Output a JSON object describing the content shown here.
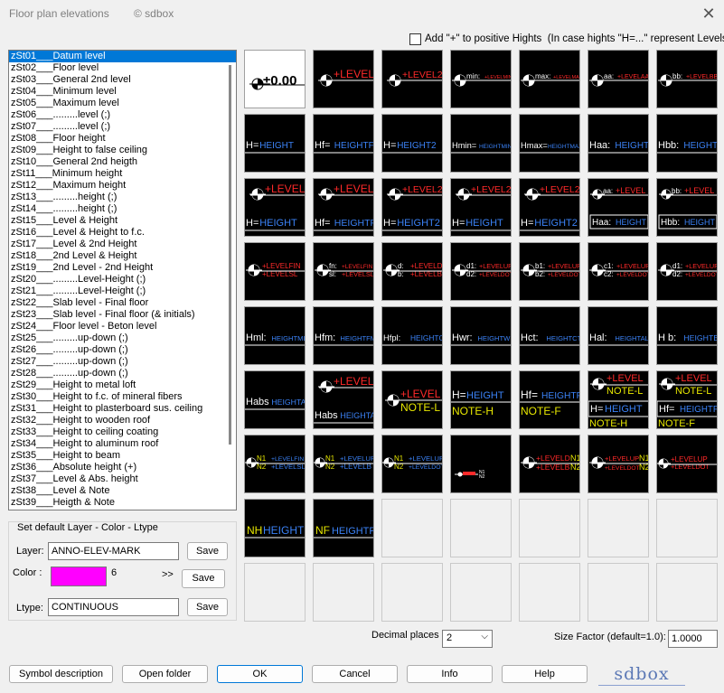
{
  "window": {
    "title": "Floor plan elevations",
    "copyright": "© sdbox",
    "close_icon": "close-icon"
  },
  "options": {
    "plus_label": "Add \"+\" to positive Hights  (In case hights \"H=...\" represent Levels).",
    "plus_checked": false
  },
  "symbols": [
    "zSt01___Datum level",
    "zSt02___Floor level",
    "zSt03___General 2nd level",
    "zSt04___Minimum level",
    "zSt05___Maximum level",
    "zSt06___.........level (;)",
    "zSt07___.........level (;)",
    "zSt08___Floor height",
    "zSt09___Height to false ceiling",
    "zSt10___General 2nd heigth",
    "zSt11___Minimum height",
    "zSt12___Maximum height",
    "zSt13___.........height (;)",
    "zSt14___.........height (;)",
    "zSt15___Level & Height",
    "zSt16___Level & Height to f.c.",
    "zSt17___Level & 2nd Height",
    "zSt18___2nd Level & Height",
    "zSt19___2nd Level - 2nd Height",
    "zSt20___.........Level-Height (;)",
    "zSt21___.........Level-Height (;)",
    "zSt22___Slab level - Final floor",
    "zSt23___Slab level - Final floor (& initials)",
    "zSt24___Floor level - Beton level",
    "zSt25___.........up-down (;)",
    "zSt26___.........up-down (;)",
    "zSt27___.........up-down (;)",
    "zSt28___.........up-down (;)",
    "zSt29___Height to metal loft",
    "zSt30___Height to f.c. of mineral fibers",
    "zSt31___Height to plasterboard sus. ceiling",
    "zSt32___Height to wooden roof",
    "zSt33___Height to ceiling coating",
    "zSt34___Height to aluminum roof",
    "zSt35___Height to beam",
    "zSt36___Absolute height (+)",
    "zSt37___Level & Abs. height",
    "zSt38___Level & Note",
    "zSt39___Heigth & Note"
  ],
  "selected_index": 0,
  "defaults": {
    "group_label": "Set default Layer - Color - Ltype",
    "layer_label": "Layer:",
    "layer_value": "ANNO-ELEV-MARK",
    "color_label": "Color :",
    "color_value": "6",
    "color_hex": "#ff00ff",
    "more_label": ">>",
    "ltype_label": "Ltype:",
    "ltype_value": "CONTINUOUS",
    "save_label": "Save"
  },
  "cells": [
    {
      "t": "datum",
      "a": "±0.00"
    },
    {
      "t": "lv",
      "a": "+LEVEL"
    },
    {
      "t": "lv",
      "a": "+LEVEL2"
    },
    {
      "t": "lvs",
      "p": "min:",
      "a": "+LEVELMIN"
    },
    {
      "t": "lvs",
      "p": "max:",
      "a": "+LEVELMAX"
    },
    {
      "t": "lvs",
      "p": "aa:",
      "a": "+LEVELAA"
    },
    {
      "t": "lvs",
      "p": "bb:",
      "a": "+LEVELBB"
    },
    {
      "t": "h",
      "p": "H=",
      "b": "HEIGHT"
    },
    {
      "t": "h",
      "p": "Hf=",
      "b": "HEIGHTF"
    },
    {
      "t": "h",
      "p": "H=",
      "b": "HEIGHT2"
    },
    {
      "t": "h",
      "p": "Hmin=",
      "b": "HEIGHTMIN"
    },
    {
      "t": "h",
      "p": "Hmax=",
      "b": "HEIGHTMAX"
    },
    {
      "t": "h",
      "p": "Haa:",
      "b": "HEIGHT"
    },
    {
      "t": "h",
      "p": "Hbb:",
      "b": "HEIGHT"
    },
    {
      "t": "lh",
      "a": "+LEVEL",
      "p": "H=",
      "b": "HEIGHT"
    },
    {
      "t": "lh",
      "a": "+LEVEL",
      "p": "Hf=",
      "b": "HEIGHTF"
    },
    {
      "t": "lh",
      "a": "+LEVEL2",
      "p": "H=",
      "b": "HEIGHT2"
    },
    {
      "t": "lh",
      "a": "+LEVEL2",
      "p": "H=",
      "b": "HEIGHT"
    },
    {
      "t": "lh",
      "a": "+LEVEL2",
      "p": "H=",
      "b": "HEIGHT2"
    },
    {
      "t": "lhs",
      "p0": "aa:",
      "a": "+LEVEL",
      "p": "Haa:",
      "b": "HEIGHT"
    },
    {
      "t": "lhs",
      "p0": "bb:",
      "a": "+LEVEL",
      "p": "Hbb:",
      "b": "HEIGHT"
    },
    {
      "t": "two",
      "a": "+LEVELFIN",
      "c": "+LEVELSL"
    },
    {
      "t": "two",
      "p": "fn:",
      "q": "sl:",
      "a": "+LEVELFIN",
      "c": "+LEVELSL"
    },
    {
      "t": "two",
      "p": "d:",
      "q": "b:",
      "a": "+LEVELD",
      "c": "+LEVELB"
    },
    {
      "t": "two",
      "p": "d1:",
      "q": "d2:",
      "a": "+LEVELUP",
      "c": "+LEVELDOT"
    },
    {
      "t": "two",
      "p": "b1:",
      "q": "b2:",
      "a": "+LEVELUP",
      "c": "+LEVELDOT"
    },
    {
      "t": "two",
      "p": "c1:",
      "q": "c2:",
      "a": "+LEVELUP",
      "c": "+LEVELDOT"
    },
    {
      "t": "two",
      "p": "d1:",
      "q": "d2:",
      "a": "+LEVELUP",
      "c": "+LEVELDOT"
    },
    {
      "t": "h",
      "p": "Hml:",
      "b": "HEIGHTML"
    },
    {
      "t": "h",
      "p": "Hfm:",
      "b": "HEIGHTFM"
    },
    {
      "t": "h",
      "p": "Hfpl:",
      "b": "HEIGHTG"
    },
    {
      "t": "h",
      "p": "Hwr:",
      "b": "HEIGHTWR"
    },
    {
      "t": "h",
      "p": "Hct:",
      "b": "HEIGHTCT"
    },
    {
      "t": "h",
      "p": "Hal:",
      "b": "HEIGHTAL"
    },
    {
      "t": "h",
      "p": "H b:",
      "b": "HEIGHTB"
    },
    {
      "t": "h",
      "p": "Habs",
      "b": "HEIGHTA"
    },
    {
      "t": "lh",
      "a": "+LEVEL",
      "p": "Habs",
      "b": "HEIGHTA"
    },
    {
      "t": "ln",
      "a": "+LEVEL",
      "n": "NOTE-L"
    },
    {
      "t": "hn",
      "p": "H=",
      "b": "HEIGHT",
      "n": "NOTE-H"
    },
    {
      "t": "hn",
      "p": "Hf=",
      "b": "HEIGHTF",
      "n": "NOTE-F"
    },
    {
      "t": "lnh",
      "a": "+LEVEL",
      "n": "NOTE-L",
      "p": "H=",
      "b": "HEIGHT",
      "m": "NOTE-H"
    },
    {
      "t": "lnh",
      "a": "+LEVEL",
      "n": "NOTE-L",
      "p": "Hf=",
      "b": "HEIGHTF",
      "m": "NOTE-F"
    },
    {
      "t": "nn",
      "a": "+LEVELFIN",
      "c": "+LEVELSL",
      "p": "N1",
      "q": "N2"
    },
    {
      "t": "nn",
      "a": "+LEVELUP",
      "c": "+LEVELB",
      "p": "N1",
      "q": "N2"
    },
    {
      "t": "nn",
      "a": "+LEVELUP",
      "c": "+LEVELDOT",
      "p": "N1",
      "q": "N2"
    },
    {
      "t": "tiny",
      "p": "N1",
      "q": "N2"
    },
    {
      "t": "nnr",
      "a": "+LEVELD",
      "c": "+LEVELB",
      "p": "N1",
      "q": "N2"
    },
    {
      "t": "nnr",
      "a": "+LEVELUP",
      "c": "+LEVELDOT",
      "p": "N1",
      "q": "N2"
    },
    {
      "t": "mono",
      "a": "+LEVELUP",
      "c": "+LEVELDOT"
    },
    {
      "t": "nh",
      "p": "NH",
      "b": "HEIGHT"
    },
    {
      "t": "nh",
      "p": "NF",
      "b": "HEIGHTF"
    },
    {
      "t": "blank"
    },
    {
      "t": "blank"
    },
    {
      "t": "blank"
    },
    {
      "t": "blank"
    },
    {
      "t": "blank"
    },
    {
      "t": "blank"
    },
    {
      "t": "blank"
    },
    {
      "t": "blank"
    },
    {
      "t": "blank"
    },
    {
      "t": "blank"
    },
    {
      "t": "blank"
    },
    {
      "t": "blank"
    }
  ],
  "colors": {
    "red": "#ff2a2a",
    "blue": "#3b82f6",
    "yellow": "#e8e800",
    "white": "#ffffff"
  },
  "settings": {
    "decimal_label": "Decimal places",
    "decimal_value": "2",
    "size_label": "Size Factor (default=1.0):",
    "size_value": "1.0000"
  },
  "buttons": {
    "symbol_description": "Symbol description",
    "open_folder": "Open folder",
    "ok": "OK",
    "cancel": "Cancel",
    "info": "Info",
    "help": "Help"
  },
  "logo": "sdbox"
}
